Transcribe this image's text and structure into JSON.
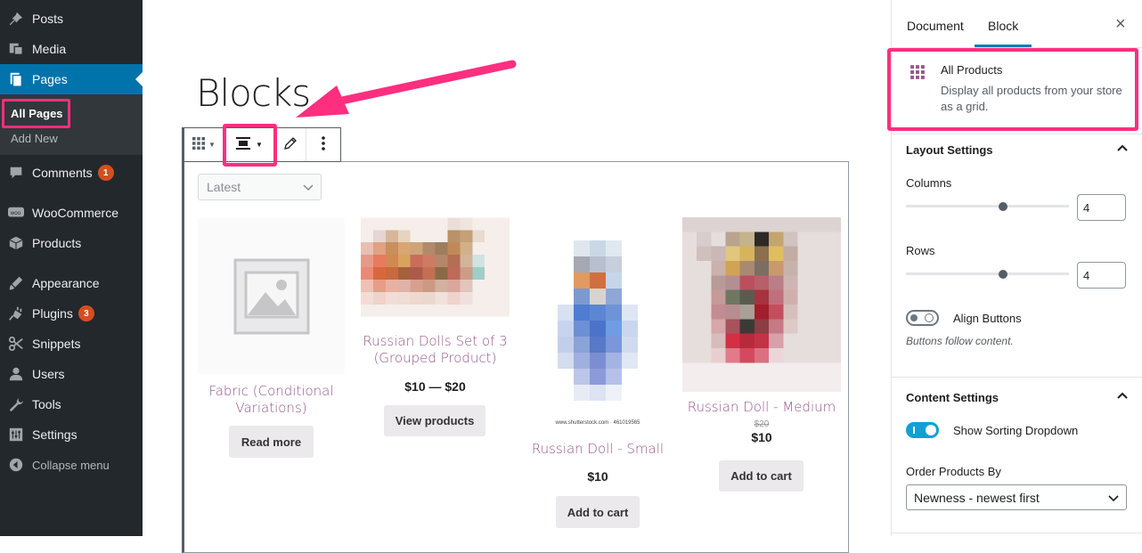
{
  "sidebar": {
    "items": [
      {
        "label": "Posts",
        "icon": "pin-icon"
      },
      {
        "label": "Media",
        "icon": "media-icon"
      },
      {
        "label": "Pages",
        "icon": "pages-icon"
      },
      {
        "label": "Comments",
        "icon": "comments-icon",
        "badge": "1"
      },
      {
        "label": "WooCommerce",
        "icon": "woo-icon"
      },
      {
        "label": "Products",
        "icon": "products-icon"
      },
      {
        "label": "Appearance",
        "icon": "appearance-icon"
      },
      {
        "label": "Plugins",
        "icon": "plugins-icon",
        "badge": "3"
      },
      {
        "label": "Snippets",
        "icon": "snippets-icon"
      },
      {
        "label": "Users",
        "icon": "users-icon"
      },
      {
        "label": "Tools",
        "icon": "tools-icon"
      },
      {
        "label": "Settings",
        "icon": "settings-icon"
      },
      {
        "label": "Collapse menu",
        "icon": "collapse-icon"
      }
    ],
    "submenu": [
      "All Pages",
      "Add New"
    ]
  },
  "editor": {
    "page_title": "Blocks",
    "sort_dropdown": "Latest",
    "products": [
      {
        "name": "Fabric (Conditional Variations)",
        "price": "",
        "button": "Read more"
      },
      {
        "name": "Russian Dolls Set of 3 (Grouped Product)",
        "price": "$10 — $20",
        "button": "View products"
      },
      {
        "name": "Russian Doll - Small",
        "price": "$10",
        "button": "Add to cart",
        "caption": "www.shutterstock.com · 461019565"
      },
      {
        "name": "Russian Doll - Medium",
        "old_price": "$20",
        "price": "$10",
        "button": "Add to cart"
      }
    ]
  },
  "inspector": {
    "tabs": [
      "Document",
      "Block"
    ],
    "active_tab": "Block",
    "close": "×",
    "block": {
      "title": "All Products",
      "description": "Display all products from your store as a grid."
    },
    "layout": {
      "title": "Layout Settings",
      "columns_label": "Columns",
      "columns_value": "4",
      "rows_label": "Rows",
      "rows_value": "4",
      "align_label": "Align Buttons",
      "align_help": "Buttons follow content."
    },
    "content": {
      "title": "Content Settings",
      "sorting_label": "Show Sorting Dropdown",
      "order_label": "Order Products By",
      "order_value": "Newness - newest first"
    }
  },
  "colors": {
    "accent": "#0073aa",
    "highlight": "#ff2e7e",
    "product_name": "#96588a",
    "toggle_on": "#11a0d2"
  }
}
